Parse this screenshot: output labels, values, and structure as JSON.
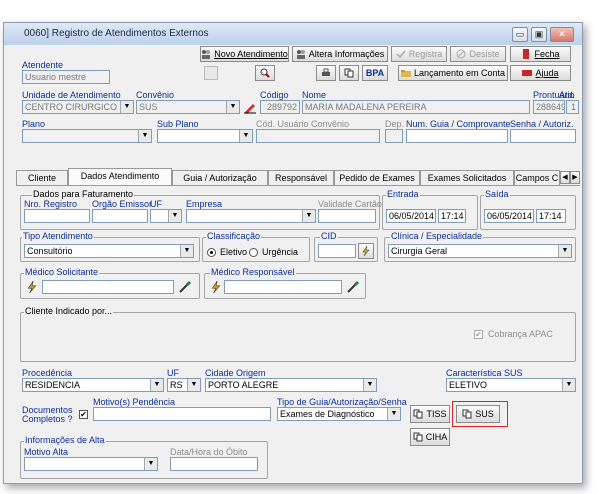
{
  "window": {
    "title": "0060] Registro de Atendimentos Externos",
    "min": "▭",
    "max": "▣",
    "close": "✕"
  },
  "toolbar": {
    "novo_atendimento": "Novo Atendimento",
    "altera_informacoes": "Altera Informações",
    "registra": "Registra",
    "desiste": "Desiste",
    "fecha": "Fecha",
    "bpa": "BPA",
    "lancamento_em_conta": "Lançamento em Conta",
    "ajuda": "Ajuda"
  },
  "atendente": {
    "label": "Atendente",
    "value": "Usuario mestre"
  },
  "unidade": {
    "label": "Unidade de Atendimento",
    "value": "CENTRO CIRURGICO"
  },
  "convenio": {
    "label": "Convênio",
    "value": "SUS"
  },
  "codigo": {
    "label": "Código",
    "value": "289792"
  },
  "nome": {
    "label": "Nome",
    "value": "MARIA MADALENA PEREIRA"
  },
  "prontuario": {
    "label": "Prontuário",
    "value": "288649"
  },
  "atd": {
    "label": "Atd.",
    "value": "1"
  },
  "plano": {
    "label": "Plano"
  },
  "subplano": {
    "label": "Sub Plano"
  },
  "cod_usuario": {
    "label": "Cód. Usuário Convênio"
  },
  "dep": {
    "label": "Dep."
  },
  "num_guia": {
    "label": "Num. Guia / Comprovante"
  },
  "senha": {
    "label": "Senha / Autoriz."
  },
  "tabs": [
    {
      "label": "Cliente"
    },
    {
      "label": "Dados Atendimento"
    },
    {
      "label": "Guia / Autorização"
    },
    {
      "label": "Responsável"
    },
    {
      "label": "Pedido de Exames"
    },
    {
      "label": "Exames Solicitados"
    },
    {
      "label": "Campos C"
    }
  ],
  "faturamento": {
    "group": "Dados para Faturamento",
    "nro_registro": "Nro. Registro",
    "orgao_emissor": "Orgão Emissor",
    "uf": "UF",
    "empresa": "Empresa",
    "validade_cartao": "Validade Cartão"
  },
  "entrada": {
    "label": "Entrada",
    "date": "06/05/2014",
    "time": "17:14"
  },
  "saida": {
    "label": "Saída",
    "date": "06/05/2014",
    "time": "17:14"
  },
  "tipo_atendimento": {
    "label": "Tipo Atendimento",
    "value": "Consultório"
  },
  "classificacao": {
    "label": "Classificação",
    "eletivo": "Eletivo",
    "urgencia": "Urgência"
  },
  "cid": {
    "label": "CID"
  },
  "clinica": {
    "label": "Clínica / Especialidade",
    "value": "Cirurgia Geral"
  },
  "medico_solicitante": {
    "label": "Médico Solicitante"
  },
  "medico_responsavel": {
    "label": "Médico Responsável"
  },
  "cliente_indicado": {
    "label": "Cliente Indicado por..."
  },
  "cobranca_apac": {
    "label": "Cobrança APAC",
    "check": "✔"
  },
  "procedencia": {
    "label": "Procedência",
    "value": "RESIDENCIA"
  },
  "uf2": {
    "label": "UF",
    "value": "RS"
  },
  "cidade_origem": {
    "label": "Cidade Origem",
    "value": "PORTO ALEGRE"
  },
  "caracteristica_sus": {
    "label": "Característica SUS",
    "value": "ELETIVO"
  },
  "documentos": {
    "label1": "Documentos",
    "label2": "Completos ?",
    "check": "✔"
  },
  "motivos_pendencia": {
    "label": "Motivo(s) Pendência"
  },
  "tipo_guia": {
    "label": "Tipo de Guia/Autorização/Senha",
    "value": "Exames de Diagnóstico"
  },
  "buttons": {
    "tiss": "TISS",
    "sus": "SUS",
    "ciha": "CIHA"
  },
  "alta": {
    "group": "Informações de Alta",
    "motivo": "Motivo Alta",
    "data_obito": "Data/Hora do Óbito"
  },
  "colors": {
    "highlight": "#d9262b",
    "label_blue": "#0b2e9a"
  }
}
